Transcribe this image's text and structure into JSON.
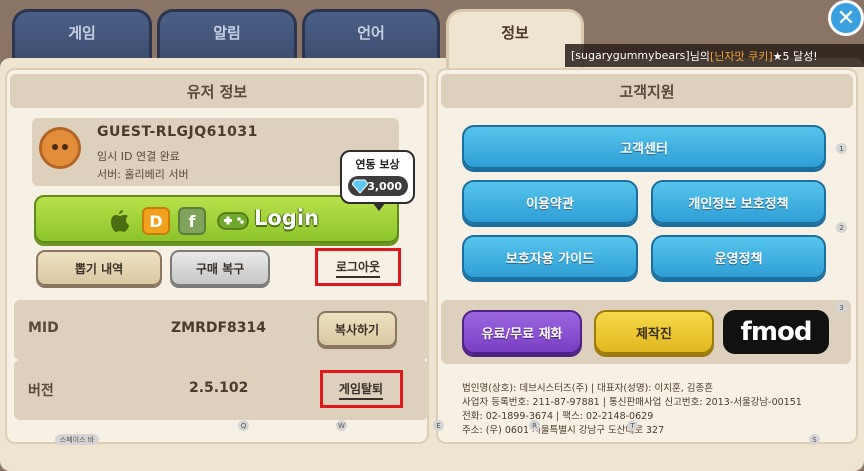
{
  "tabs": [
    {
      "label": "게임",
      "active": false
    },
    {
      "label": "알림",
      "active": false
    },
    {
      "label": "언어",
      "active": false
    },
    {
      "label": "정보",
      "active": true
    }
  ],
  "notice": {
    "user": "[sugarygummybears]",
    "middle": "님의 ",
    "cookie": "[닌자맛 쿠키]",
    "achievement": " ★5 달성!"
  },
  "user_info": {
    "title": "유저 정보",
    "guest_id": "GUEST-RLGJQ61031",
    "link_status": "임시 ID 연결 완료",
    "server": "서버: 홀리베리 서버",
    "reward_title": "연동 보상",
    "reward_value": "3,000",
    "login_label": "Login",
    "platform_d": "D",
    "platform_f": "f",
    "gacha_history": "뽑기 내역",
    "restore_purchase": "구매 복구",
    "logout": "로그아웃",
    "mid_label": "MID",
    "mid_value": "ZMRDF8314",
    "copy": "복사하기",
    "version_label": "버전",
    "version_value": "2.5.102",
    "withdraw": "게임탈퇴"
  },
  "support": {
    "title": "고객지원",
    "customer_center": "고객센터",
    "terms": "이용약관",
    "privacy": "개인정보 보호정책",
    "guardian_guide": "보호자용 가이드",
    "policy": "운영정책",
    "paid_free": "유료/무료 재화",
    "credits": "제작진",
    "fmod_logo": "fmod",
    "company_info": [
      "법인명(상호): 데브시스터즈(주) | 대표자(성명): 이지훈, 김종흔",
      "사업자 등록번호: 211-87-97881 | 통신판매사업 신고번호: 2013-서울강남-00151",
      "전화: 02-1899-3674 | 팩스: 02-2148-0629",
      "주소: (우) 0601 서울특별시 강남구 도산대로 327"
    ]
  },
  "hotkeys": [
    "스페이스 바",
    "Q",
    "W",
    "E",
    "R",
    "T",
    "S",
    "1",
    "2",
    "3"
  ],
  "colors": {
    "accent_green": "#8dc42b",
    "accent_blue": "#2e9fd6",
    "highlight_red": "#e0181c",
    "purple": "#8a4fd0",
    "yellow": "#e7c228"
  }
}
